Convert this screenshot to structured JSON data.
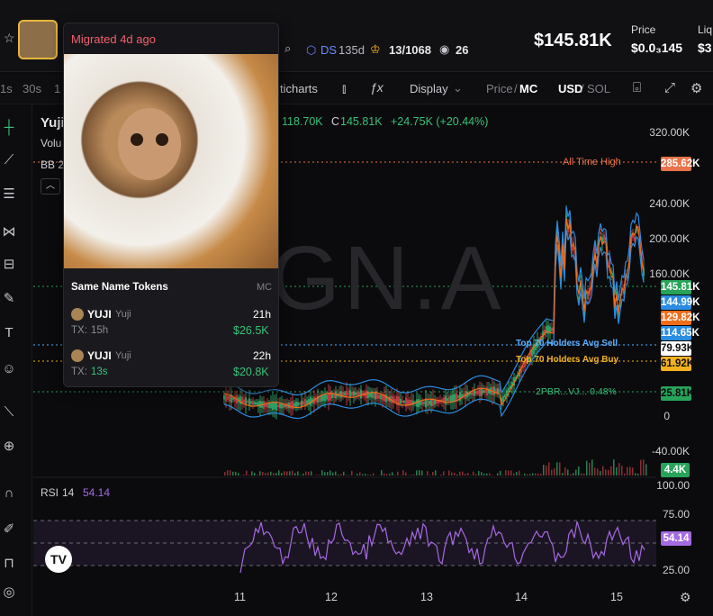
{
  "header": {
    "title_partial": "Yuji",
    "ds_label": "DS",
    "age": "135d",
    "holders": "13/1068",
    "watchers": "26",
    "market_cap": "$145.81K",
    "price_label": "Price",
    "price_value": "$0.0₃145",
    "liq_label": "Liq",
    "liq_value": "$3"
  },
  "toolbar": {
    "intervals": [
      "1s",
      "30s",
      "1"
    ],
    "candles_label": "ticharts",
    "display_label": "Display",
    "price_label": "Price",
    "mc_label": "MC",
    "usd_label": "USD",
    "sol_label": "SOL"
  },
  "legend": {
    "symbol": "Yuji",
    "vol_label": "Volu",
    "bb_label": "BB 2",
    "ohlc_high": "118.70K",
    "close_label": "C",
    "close_value": "145.81K",
    "change": "+24.75K (+20.44%)"
  },
  "watermark": "GN.A",
  "y_axis_ticks": [
    "320.00K",
    "240.00K",
    "200.00K",
    "160.00K",
    "0",
    "-40.00K"
  ],
  "price_tags": [
    {
      "label": "285.62K",
      "color": "#e8734a"
    },
    {
      "label": "145.81K",
      "color": "#27a35a"
    },
    {
      "label": "144.99K",
      "color": "#2b8ce0"
    },
    {
      "label": "129.82K",
      "color": "#ef6c1a"
    },
    {
      "label": "114.65K",
      "color": "#2b8ce0"
    },
    {
      "label": "79.93K",
      "color": "#ffffff"
    },
    {
      "label": "61.92K",
      "color": "#f2b21f"
    },
    {
      "label": "25.81K",
      "color": "#27a35a"
    },
    {
      "label": "4.4K",
      "color": "#27a35a"
    }
  ],
  "annotations": {
    "ath": "All Time High",
    "top70_sell": "Top 70 Holders Avg Sell",
    "top70_buy": "Top 70 Holders Avg Buy",
    "dev": "2PBR...VJ... 0.48%"
  },
  "rsi": {
    "label": "RSI",
    "period": "14",
    "value": "54.14",
    "ticks": [
      "100.00",
      "75.00",
      "25.00"
    ],
    "tag": "54.14"
  },
  "x_axis_ticks": [
    "11",
    "12",
    "13",
    "14",
    "15"
  ],
  "popup": {
    "badge": "Migrated 4d ago",
    "section_title": "Same Name Tokens",
    "section_right": "MC",
    "items": [
      {
        "name": "YUJI",
        "sub": "Yuji",
        "age": "21h",
        "tx_label": "TX:",
        "tx": "15h",
        "mc": "$26.5K"
      },
      {
        "name": "YUJI",
        "sub": "Yuji",
        "age": "22h",
        "tx_label": "TX:",
        "tx": "13s",
        "mc": "$20.8K"
      }
    ]
  },
  "colors": {
    "green": "#38c179",
    "red": "#e5484d",
    "blue_band": "#2b8ce0",
    "orange_ma": "#ef6c1a",
    "rsi_line": "#a46ae0",
    "badge": "#f0606a"
  }
}
